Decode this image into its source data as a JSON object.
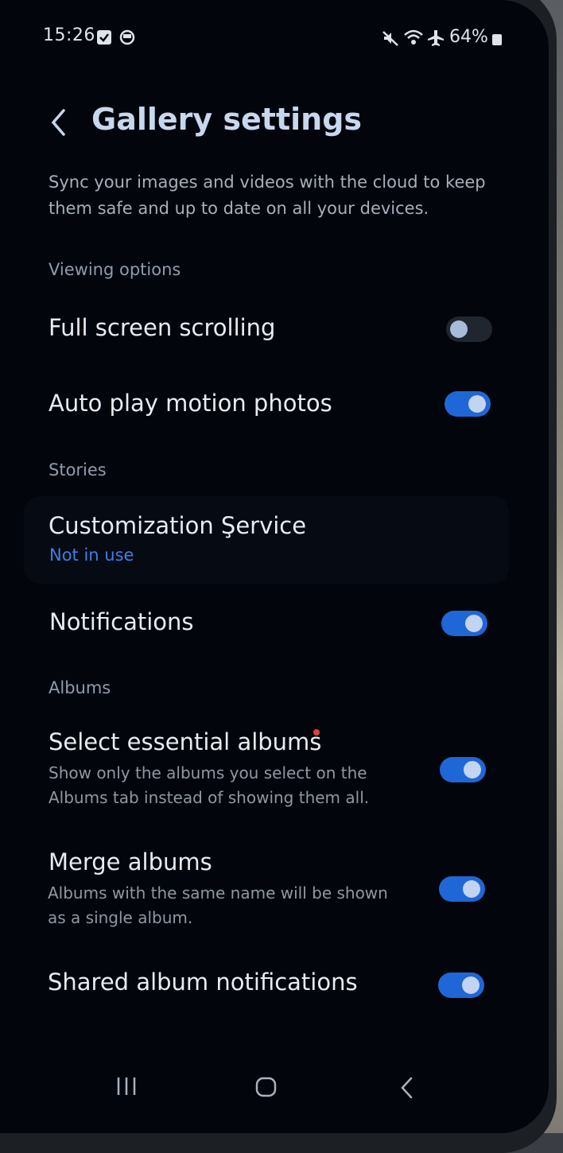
{
  "status_bar": {
    "time": "15:26",
    "battery": "64%"
  },
  "header": {
    "title": "Gallery settings"
  },
  "cloud_sync": {
    "description": "Sync your images and videos with the cloud to keep them safe and up to date on all your devices."
  },
  "sections": {
    "viewing": "Viewing options",
    "stories": "Stories",
    "albums": "Albums"
  },
  "items": {
    "full_screen_scrolling": {
      "title": "Full screen scrolling",
      "enabled": false
    },
    "auto_play_motion": {
      "title": "Auto play motion photos",
      "enabled": true
    },
    "customization_service": {
      "title": "Customization Şervice",
      "status": "Not in use"
    },
    "notifications": {
      "title": "Notifications",
      "enabled": true
    },
    "select_essential_albums": {
      "title": "Select essential albums",
      "subtitle_line1": "Show only the albums you select on the",
      "subtitle_line2": "Albums tab instead of showing them all.",
      "enabled": true
    },
    "merge_albums": {
      "title": "Merge albums",
      "subtitle_line1": "Albums with the same name will be shown",
      "subtitle_line2": "as a single album.",
      "enabled": true
    },
    "shared_album_notifications": {
      "title": "Shared album notifications",
      "enabled": true
    }
  },
  "colors": {
    "toggle_on": "#1f67d6",
    "accent_status": "#3d7fe9",
    "background": "#02050b"
  }
}
